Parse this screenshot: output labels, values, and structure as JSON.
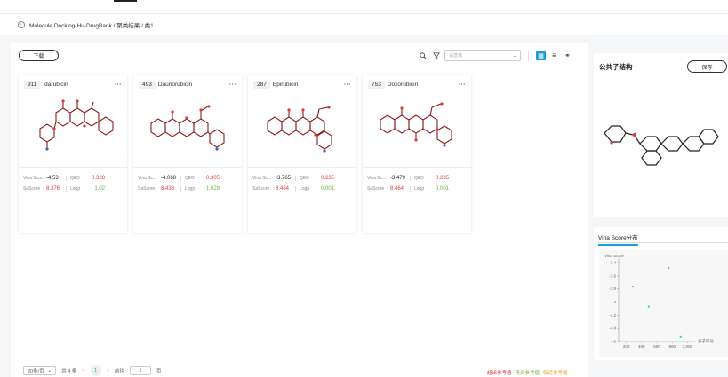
{
  "breadcrumb": "Molecule Docking-Hu-DrugBank / 聚类结果 / 类1",
  "toolbar": {
    "download_label": "下载",
    "search_placeholder": "请选择"
  },
  "cards": [
    {
      "id": "911",
      "name": "Idarubicin",
      "vina_label": "Vina Scor...",
      "vina": "-4.53",
      "qed": "0.328",
      "sascore": "8.376",
      "logp": "1.02"
    },
    {
      "id": "493",
      "name": "Daunorubicin",
      "vina_label": "Vina Sc...",
      "vina": "-4.068",
      "qed": "0.305",
      "sascore": "8.438",
      "logp": "1.029"
    },
    {
      "id": "287",
      "name": "Epirubicin",
      "vina_label": "Vina Sc...",
      "vina": "-3.765",
      "qed": "0.235",
      "sascore": "8.464",
      "logp": "0.001"
    },
    {
      "id": "753",
      "name": "Doxorubicin",
      "vina_label": "Vina Sc...",
      "vina": "-3.479",
      "qed": "0.235",
      "sascore": "8.464",
      "logp": "0.001"
    }
  ],
  "labels": {
    "qed": "QED",
    "sascore": "SaScore",
    "logp": "Logp",
    "more": "···"
  },
  "pagination": {
    "page_size": "20条/页",
    "total": "共 4 条",
    "current": "1",
    "goto_label": "前往",
    "goto_value": "1",
    "page_unit": "页",
    "prev": "<",
    "next": ">"
  },
  "legend": {
    "exceed": "超出参考值",
    "meet": "符合参考值",
    "near": "临近参考值"
  },
  "side": {
    "title": "公共子结构",
    "save_label": "保存"
  },
  "chart_panel": {
    "tab": "Vina Score分布"
  },
  "chart_data": {
    "type": "scatter",
    "ylabel": "Vina Score",
    "xlabel": "分子序号",
    "xlim": [
      100,
      1100
    ],
    "ylim": [
      -4.6,
      -3.4
    ],
    "x_ticks": [
      200,
      400,
      600,
      800,
      "1,000"
    ],
    "y_ticks": [
      "-3.4",
      "-3.6",
      "-3.8",
      "-4",
      "-4.2",
      "-4.4",
      "-4.6"
    ],
    "points": [
      {
        "x": 287,
        "y": -3.765
      },
      {
        "x": 493,
        "y": -4.068
      },
      {
        "x": 753,
        "y": -3.479
      },
      {
        "x": 911,
        "y": -4.53
      }
    ],
    "point_color": "#3ac4a0"
  },
  "colors": {
    "accent": "#1aa0d8",
    "red": "#e03b3b",
    "green": "#6db33f",
    "orange": "#f0a030"
  }
}
